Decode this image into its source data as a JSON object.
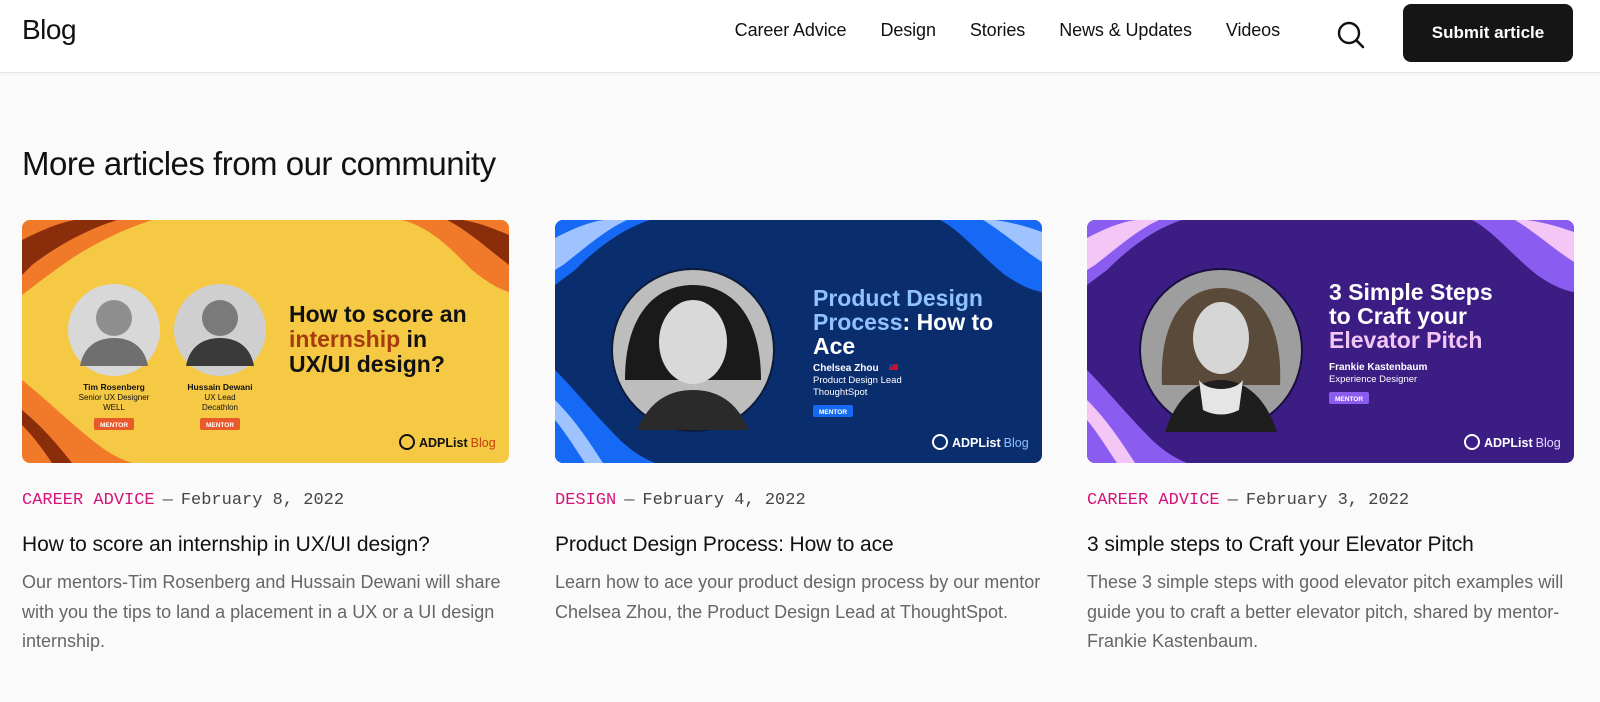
{
  "header": {
    "brand": "Blog",
    "nav": [
      "Career Advice",
      "Design",
      "Stories",
      "News & Updates",
      "Videos"
    ],
    "search_icon": "search-icon",
    "submit_label": "Submit article"
  },
  "section": {
    "title": "More articles from our community"
  },
  "articles": [
    {
      "category": "CAREER ADVICE",
      "date": "February 8, 2022",
      "title": "How to score an internship in UX/UI design?",
      "description": "Our mentors-Tim Rosenberg and Hussain Dewani will share with you the tips to land a placement in a UX or a UI design internship.",
      "image": {
        "bg": "#f6c945",
        "wave": "#f07a2a",
        "wave_dark": "#8a2d0a",
        "heading_lines": [
          "How to score an",
          "internship in",
          "UX/UI design?"
        ],
        "highlight_word": "internship",
        "people": [
          {
            "name": "Tim Rosenberg",
            "role": "Senior UX Designer",
            "org": "WELL",
            "badge": "MENTOR"
          },
          {
            "name": "Hussain Dewani",
            "role": "UX Lead",
            "org": "Decathlon",
            "badge": "MENTOR"
          }
        ],
        "logo": "ADPList",
        "logo_suffix": "Blog"
      }
    },
    {
      "category": "DESIGN",
      "date": "February 4, 2022",
      "title": "Product Design Process: How to ace",
      "description": "Learn how to ace your product design process by our mentor Chelsea Zhou, the Product Design Lead at ThoughtSpot.",
      "image": {
        "bg": "#0a2d6e",
        "wave": "#1569f5",
        "wave_light": "#9ec3ff",
        "heading_lines": [
          "Product Design",
          "Process: How to",
          "Ace"
        ],
        "person": {
          "name": "Chelsea Zhou",
          "role": "Product Design Lead",
          "org": "ThoughtSpot",
          "badge": "MENTOR"
        },
        "logo": "ADPList",
        "logo_suffix": "Blog"
      }
    },
    {
      "category": "CAREER ADVICE",
      "date": "February 3, 2022",
      "title": "3 simple steps to Craft your Elevator Pitch",
      "description": "These 3 simple steps with good elevator pitch examples will guide you to craft a better elevator pitch, shared by mentor-Frankie Kastenbaum.",
      "image": {
        "bg": "#3b1d84",
        "wave": "#8b5cf0",
        "wave_light": "#f3c6f5",
        "heading_lines": [
          "3 Simple Steps",
          "to Craft your",
          "Elevator Pitch"
        ],
        "person": {
          "name": "Frankie Kastenbaum",
          "role": "Experience Designer",
          "badge": "MENTOR"
        },
        "logo": "ADPList",
        "logo_suffix": "Blog"
      }
    }
  ]
}
